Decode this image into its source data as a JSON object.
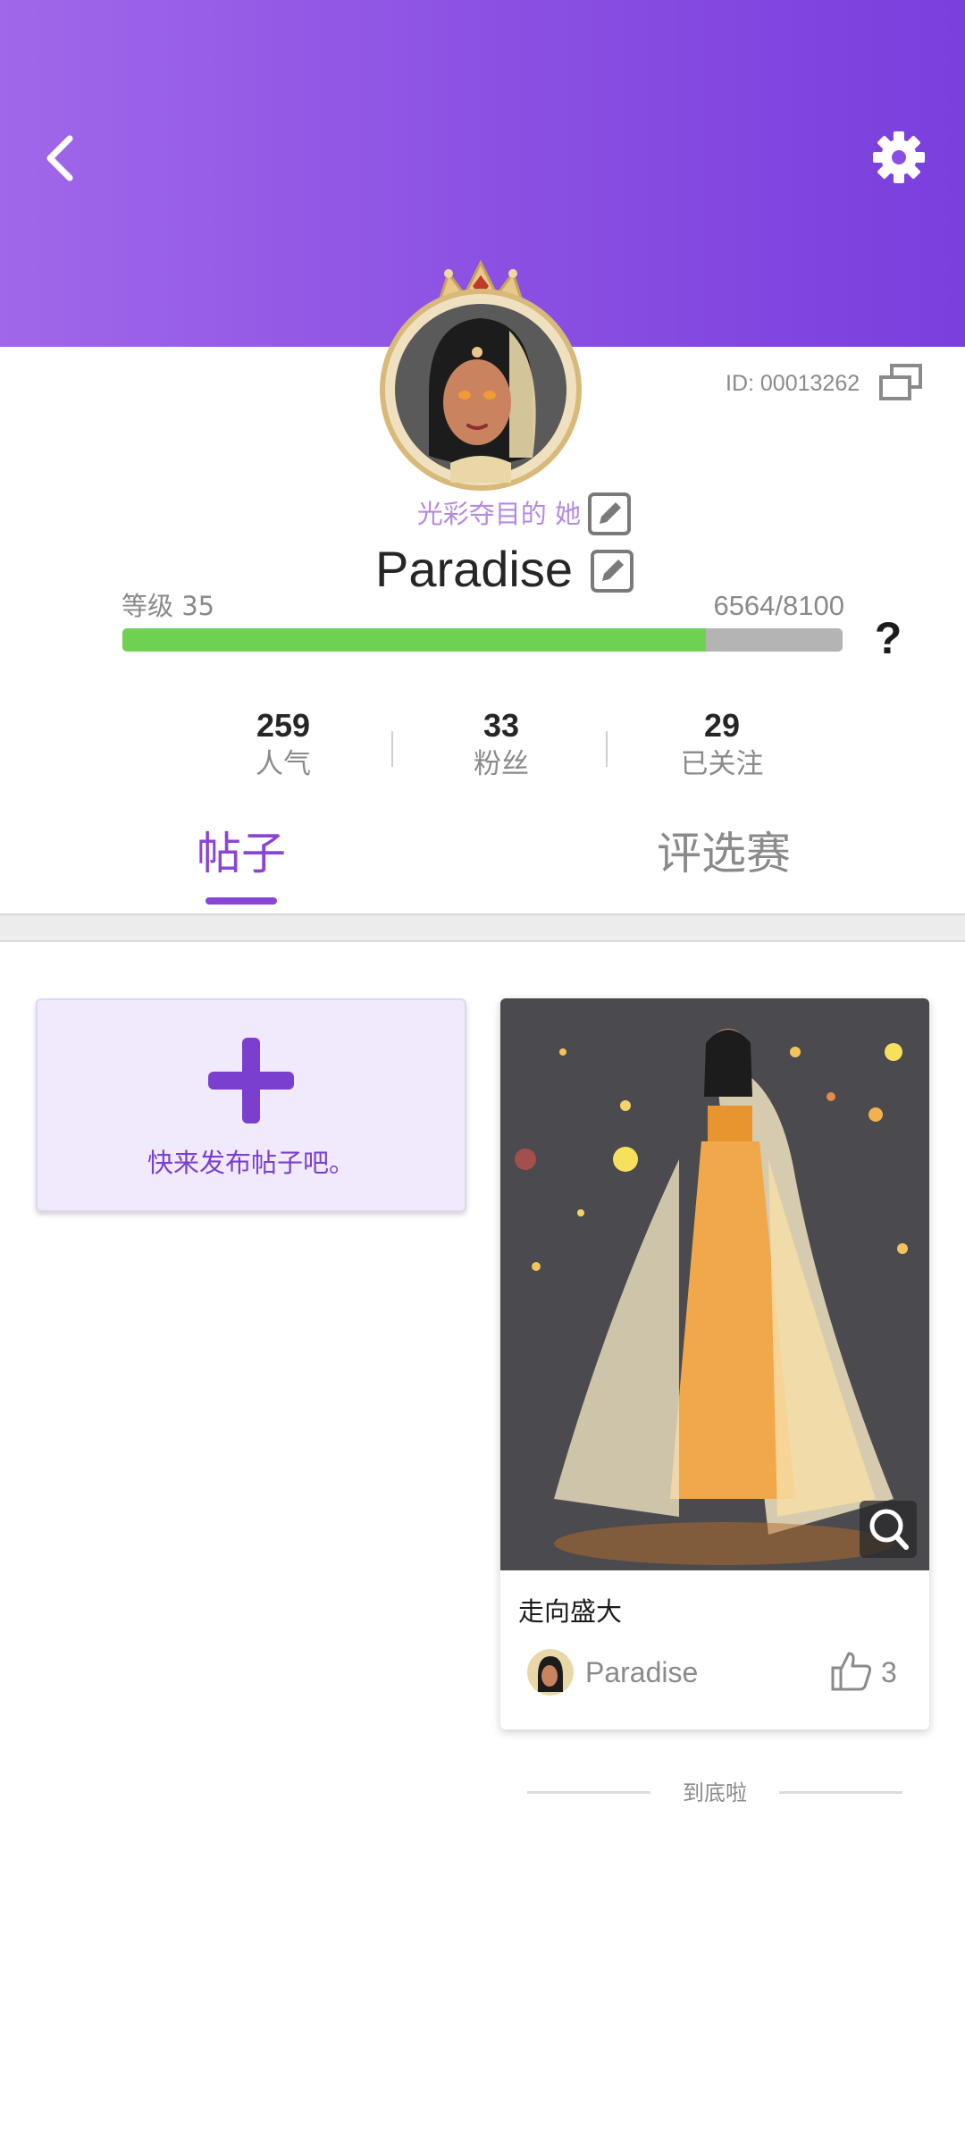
{
  "colors": {
    "header_gradient_start": "#a067ea",
    "header_gradient_end": "#7a3fdd",
    "accent": "#8a45d6",
    "progress_fill": "#6fd152",
    "progress_track": "#b4b4b4"
  },
  "header": {
    "back_icon": "chevron-left-icon",
    "settings_icon": "gear-icon"
  },
  "profile": {
    "id_label": "ID: 00013262",
    "title": "光彩夺目的 她",
    "username": "Paradise",
    "level_label": "等级 35",
    "exp_text": "6564/8100",
    "exp_current": 6564,
    "exp_max": 8100,
    "help_label": "?"
  },
  "stats": [
    {
      "value": "259",
      "label": "人气"
    },
    {
      "value": "33",
      "label": "粉丝"
    },
    {
      "value": "29",
      "label": "已关注"
    }
  ],
  "tabs": [
    {
      "label": "帖子",
      "active": true
    },
    {
      "label": "评选赛",
      "active": false
    }
  ],
  "new_post": {
    "text": "快来发布帖子吧。"
  },
  "post": {
    "title": "走向盛大",
    "author": "Paradise",
    "likes": "3"
  },
  "footer": {
    "end_text": "到底啦"
  }
}
